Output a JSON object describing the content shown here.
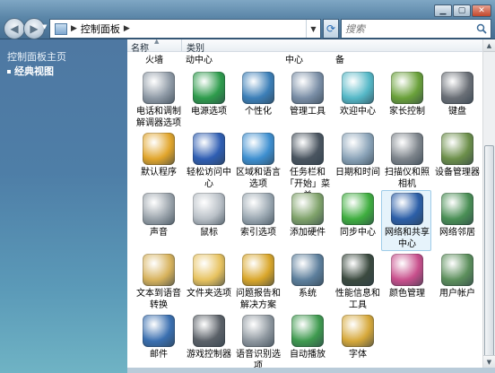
{
  "address": {
    "root_label": "控制面板"
  },
  "search": {
    "placeholder": "搜索"
  },
  "sidebar": {
    "home": "控制面板主页",
    "classic": "经典视图"
  },
  "columns": {
    "name": "名称",
    "category": "类别"
  },
  "partial_labels": [
    "火墙",
    "动中心",
    "中心",
    "备"
  ],
  "items": [
    {
      "label": "电话和调制解调器选项",
      "icon": "phone-modem-icon",
      "color": "#8f9aa6"
    },
    {
      "label": "电源选项",
      "icon": "power-options-icon",
      "color": "#2e9c4c"
    },
    {
      "label": "个性化",
      "icon": "personalization-icon",
      "color": "#3c7fb8"
    },
    {
      "label": "管理工具",
      "icon": "admin-tools-icon",
      "color": "#7a8ea6"
    },
    {
      "label": "欢迎中心",
      "icon": "welcome-center-icon",
      "color": "#55b8c7"
    },
    {
      "label": "家长控制",
      "icon": "parental-controls-icon",
      "color": "#6aa13a"
    },
    {
      "label": "键盘",
      "icon": "keyboard-icon",
      "color": "#6a6f76"
    },
    {
      "label": "默认程序",
      "icon": "default-programs-icon",
      "color": "#e1a52b"
    },
    {
      "label": "轻松访问中心",
      "icon": "ease-of-access-icon",
      "color": "#2f5eb3"
    },
    {
      "label": "区域和语言选项",
      "icon": "region-language-icon",
      "color": "#3e8fd0"
    },
    {
      "label": "任务栏和「开始」菜单",
      "icon": "taskbar-start-icon",
      "color": "#4a5560"
    },
    {
      "label": "日期和时间",
      "icon": "date-time-icon",
      "color": "#8aa3b8"
    },
    {
      "label": "扫描仪和照相机",
      "icon": "scanners-cameras-icon",
      "color": "#7d848b"
    },
    {
      "label": "设备管理器",
      "icon": "device-manager-icon",
      "color": "#6c8f4a"
    },
    {
      "label": "声音",
      "icon": "sound-icon",
      "color": "#9aa3ab"
    },
    {
      "label": "鼠标",
      "icon": "mouse-icon",
      "color": "#b8bfc6"
    },
    {
      "label": "索引选项",
      "icon": "indexing-options-icon",
      "color": "#9aa7b1"
    },
    {
      "label": "添加硬件",
      "icon": "add-hardware-icon",
      "color": "#7fa26a"
    },
    {
      "label": "同步中心",
      "icon": "sync-center-icon",
      "color": "#3fae3f"
    },
    {
      "label": "网络和共享中心",
      "icon": "network-sharing-icon",
      "color": "#2c5fa8",
      "selected": true
    },
    {
      "label": "网络邻居",
      "icon": "network-neighborhood-icon",
      "color": "#4a8f55"
    },
    {
      "label": "文本到语音转换",
      "icon": "text-to-speech-icon",
      "color": "#d7b25c"
    },
    {
      "label": "文件夹选项",
      "icon": "folder-options-icon",
      "color": "#e7c25f"
    },
    {
      "label": "问题报告和解决方案",
      "icon": "problem-reports-icon",
      "color": "#d9a62a"
    },
    {
      "label": "系统",
      "icon": "system-icon",
      "color": "#5d7f9c"
    },
    {
      "label": "性能信息和工具",
      "icon": "performance-icon",
      "color": "#3b4a3f"
    },
    {
      "label": "颜色管理",
      "icon": "color-management-icon",
      "color": "#c84f8c"
    },
    {
      "label": "用户帐户",
      "icon": "user-accounts-icon",
      "color": "#5c8f5c"
    },
    {
      "label": "邮件",
      "icon": "mail-icon",
      "color": "#3a6fb0"
    },
    {
      "label": "游戏控制器",
      "icon": "game-controllers-icon",
      "color": "#5b6168"
    },
    {
      "label": "语音识别选项",
      "icon": "speech-recognition-icon",
      "color": "#8e979f"
    },
    {
      "label": "自动播放",
      "icon": "autoplay-icon",
      "color": "#3f9a4f"
    },
    {
      "label": "字体",
      "icon": "fonts-icon",
      "color": "#d6a83a"
    }
  ]
}
